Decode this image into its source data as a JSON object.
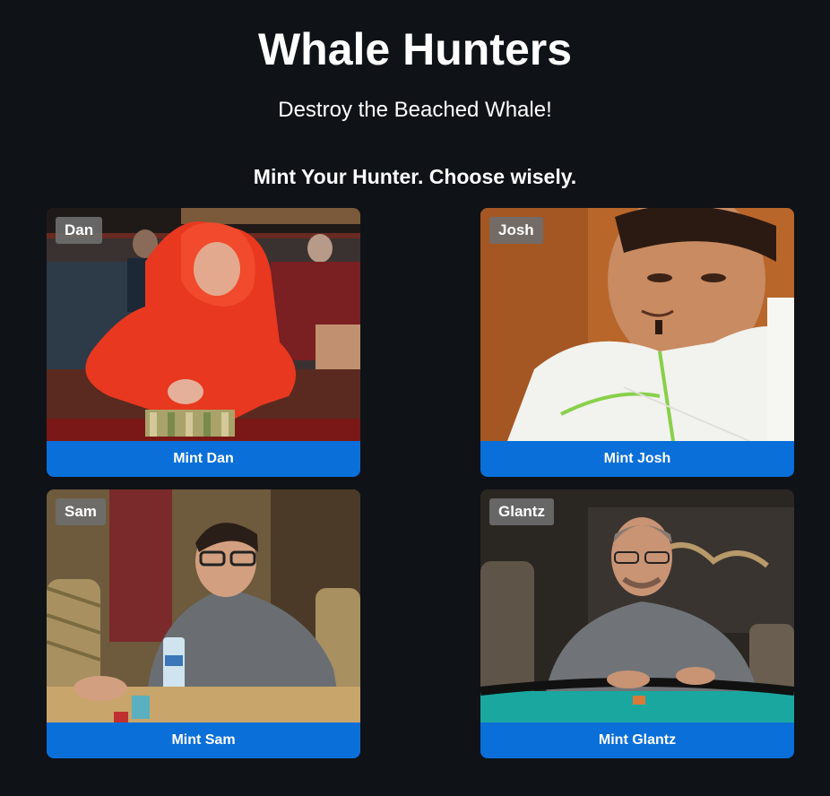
{
  "header": {
    "title": "Whale Hunters",
    "subtitle": "Destroy the Beached Whale!"
  },
  "section": {
    "heading": "Mint Your Hunter. Choose wisely."
  },
  "hunters": [
    {
      "name": "Dan",
      "button_label": "Mint Dan"
    },
    {
      "name": "Josh",
      "button_label": "Mint Josh"
    },
    {
      "name": "Sam",
      "button_label": "Mint Sam"
    },
    {
      "name": "Glantz",
      "button_label": "Mint Glantz"
    }
  ],
  "colors": {
    "background": "#0f1217",
    "button": "#0a6fd8",
    "name_tag": "#6e6e6e",
    "text": "#ffffff"
  }
}
